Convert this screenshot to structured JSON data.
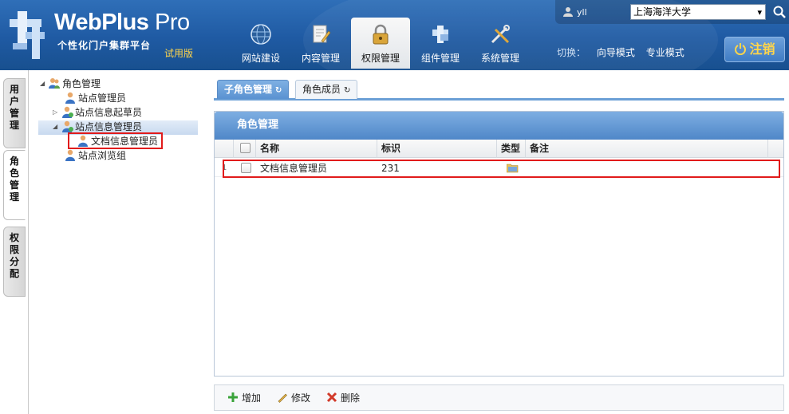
{
  "app": {
    "brand_main": "WebPlus",
    "brand_pro": " Pro",
    "subtitle": "个性化门户集群平台",
    "edition": "试用版"
  },
  "nav": {
    "items": [
      {
        "label": "网站建设",
        "icon": "globe-icon"
      },
      {
        "label": "内容管理",
        "icon": "document-edit-icon"
      },
      {
        "label": "权限管理",
        "icon": "lock-icon"
      },
      {
        "label": "组件管理",
        "icon": "puzzle-icon"
      },
      {
        "label": "系统管理",
        "icon": "tools-icon"
      }
    ],
    "active_index": 2
  },
  "mode_switch": {
    "label": "切换：",
    "guide": "向导模式",
    "pro": "专业模式"
  },
  "user": {
    "name": "yll",
    "org": "上海海洋大学"
  },
  "logout_label": "注销",
  "side_tabs": [
    "用户管理",
    "角色管理",
    "权限分配"
  ],
  "tree": {
    "root": "角色管理",
    "n1": "站点管理员",
    "n2": "站点信息起草员",
    "n3": "站点信息管理员",
    "n3_child": "文档信息管理员",
    "n4": "站点浏览组"
  },
  "tabs": [
    "子角色管理",
    "角色成员"
  ],
  "panel_title": "角色管理",
  "grid": {
    "columns": [
      "名称",
      "标识",
      "类型",
      "备注"
    ],
    "rows": [
      {
        "num": "1",
        "name": "文档信息管理员",
        "id": "231",
        "type_icon": "folder-icon",
        "note": ""
      }
    ]
  },
  "toolbar": {
    "add": "增加",
    "edit": "修改",
    "delete": "删除"
  },
  "colors": {
    "header_blue": "#1f5aa3",
    "highlight_red": "#e11b1b",
    "accent_yellow": "#ffd54a"
  }
}
